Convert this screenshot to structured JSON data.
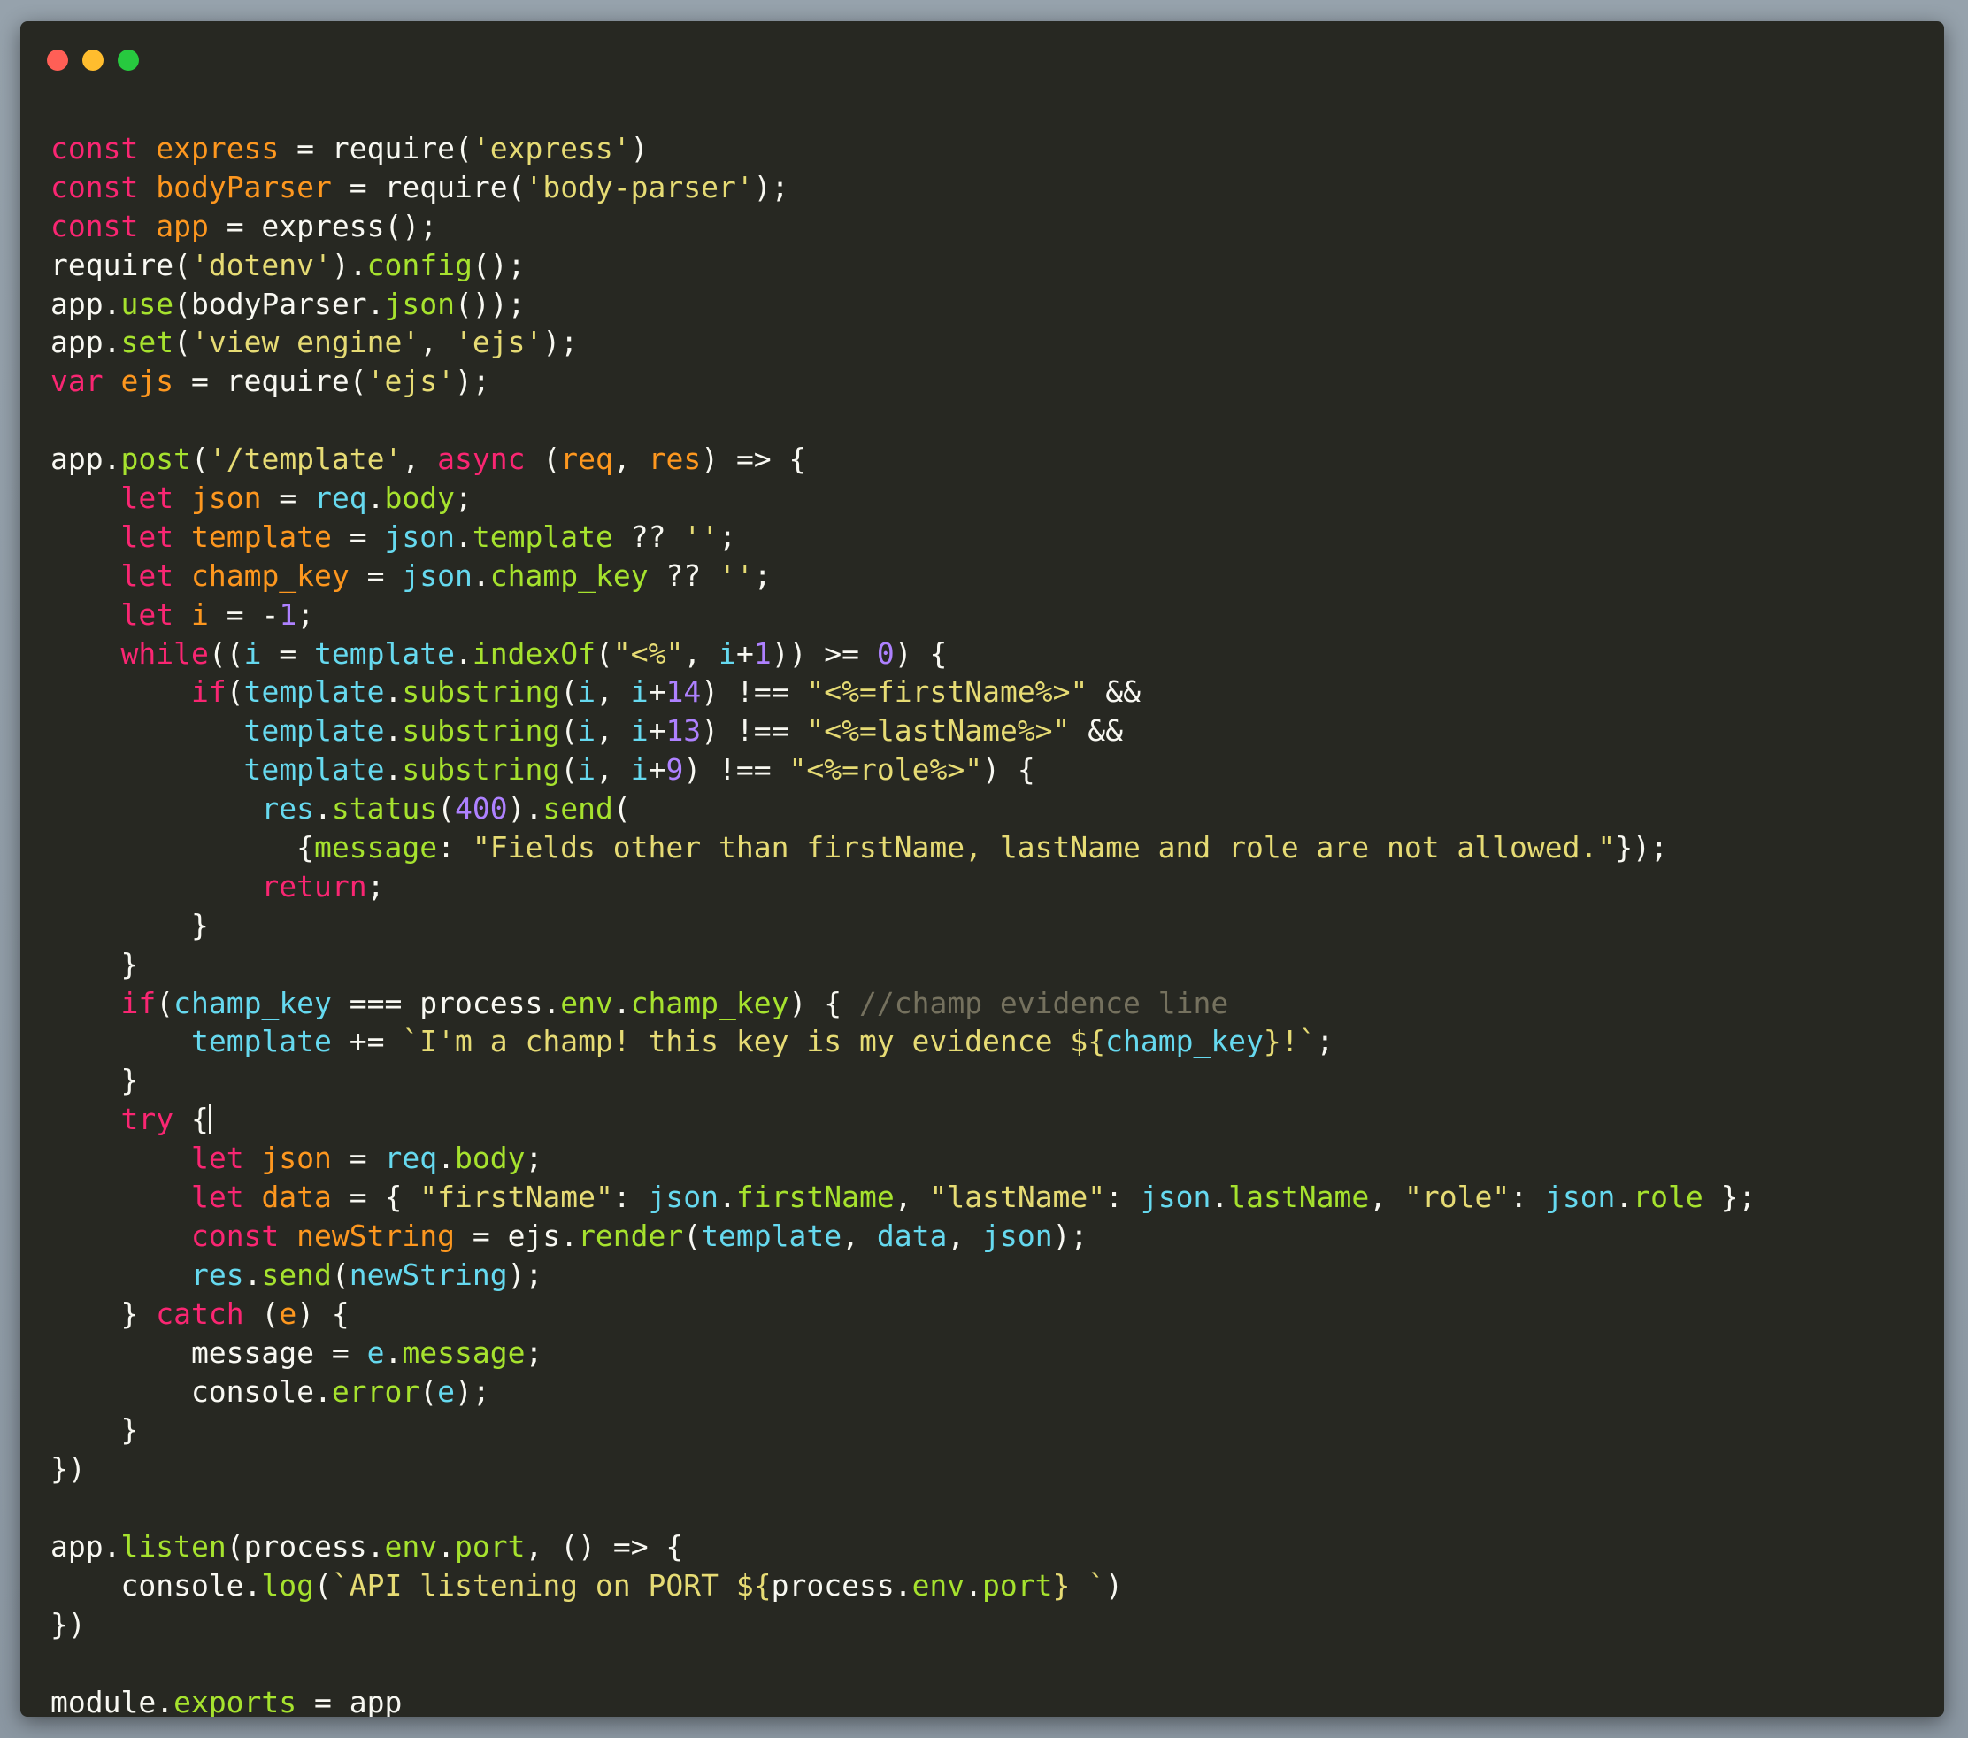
{
  "colors": {
    "background": "#272822",
    "text": "#f8f8f2",
    "keyword": "#f92672",
    "variable": "#fd971f",
    "string": "#e6db74",
    "function": "#a6e22e",
    "identifier": "#66d9ef",
    "number": "#ae81ff",
    "comment": "#75715e",
    "window_close": "#ff5f56",
    "window_minimize": "#ffbd2e",
    "window_maximize": "#27c93f"
  },
  "window_controls": [
    {
      "name": "close-button-icon",
      "color": "#ff5f56"
    },
    {
      "name": "minimize-button-icon",
      "color": "#ffbd2e"
    },
    {
      "name": "maximize-button-icon",
      "color": "#27c93f"
    }
  ],
  "cursor": {
    "line": 25
  },
  "code_lines": [
    [
      [
        "k",
        "const"
      ],
      [
        "t",
        " "
      ],
      [
        "v",
        "express"
      ],
      [
        "t",
        " = require("
      ],
      [
        "s",
        "'express'"
      ],
      [
        "t",
        ")"
      ]
    ],
    [
      [
        "k",
        "const"
      ],
      [
        "t",
        " "
      ],
      [
        "v",
        "bodyParser"
      ],
      [
        "t",
        " = require("
      ],
      [
        "s",
        "'body-parser'"
      ],
      [
        "t",
        ");"
      ]
    ],
    [
      [
        "k",
        "const"
      ],
      [
        "t",
        " "
      ],
      [
        "v",
        "app"
      ],
      [
        "t",
        " = express();"
      ]
    ],
    [
      [
        "t",
        "require("
      ],
      [
        "s",
        "'dotenv'"
      ],
      [
        "t",
        ")."
      ],
      [
        "f",
        "config"
      ],
      [
        "t",
        "();"
      ]
    ],
    [
      [
        "t",
        "app."
      ],
      [
        "f",
        "use"
      ],
      [
        "t",
        "(bodyParser."
      ],
      [
        "f",
        "json"
      ],
      [
        "t",
        "());"
      ]
    ],
    [
      [
        "t",
        "app."
      ],
      [
        "f",
        "set"
      ],
      [
        "t",
        "("
      ],
      [
        "s",
        "'view engine'"
      ],
      [
        "t",
        ", "
      ],
      [
        "s",
        "'ejs'"
      ],
      [
        "t",
        ");"
      ]
    ],
    [
      [
        "k",
        "var"
      ],
      [
        "t",
        " "
      ],
      [
        "v",
        "ejs"
      ],
      [
        "t",
        " = require("
      ],
      [
        "s",
        "'ejs'"
      ],
      [
        "t",
        ");"
      ]
    ],
    [],
    [
      [
        "t",
        "app."
      ],
      [
        "f",
        "post"
      ],
      [
        "t",
        "("
      ],
      [
        "s",
        "'/template'"
      ],
      [
        "t",
        ", "
      ],
      [
        "k",
        "async"
      ],
      [
        "t",
        " ("
      ],
      [
        "v",
        "req"
      ],
      [
        "t",
        ", "
      ],
      [
        "v",
        "res"
      ],
      [
        "t",
        ") => {"
      ]
    ],
    [
      [
        "t",
        "    "
      ],
      [
        "k",
        "let"
      ],
      [
        "t",
        " "
      ],
      [
        "v",
        "json"
      ],
      [
        "t",
        " = "
      ],
      [
        "i",
        "req"
      ],
      [
        "t",
        "."
      ],
      [
        "f",
        "body"
      ],
      [
        "t",
        ";"
      ]
    ],
    [
      [
        "t",
        "    "
      ],
      [
        "k",
        "let"
      ],
      [
        "t",
        " "
      ],
      [
        "v",
        "template"
      ],
      [
        "t",
        " = "
      ],
      [
        "i",
        "json"
      ],
      [
        "t",
        "."
      ],
      [
        "f",
        "template"
      ],
      [
        "t",
        " ?? "
      ],
      [
        "s",
        "''"
      ],
      [
        "t",
        ";"
      ]
    ],
    [
      [
        "t",
        "    "
      ],
      [
        "k",
        "let"
      ],
      [
        "t",
        " "
      ],
      [
        "v",
        "champ_key"
      ],
      [
        "t",
        " = "
      ],
      [
        "i",
        "json"
      ],
      [
        "t",
        "."
      ],
      [
        "f",
        "champ_key"
      ],
      [
        "t",
        " ?? "
      ],
      [
        "s",
        "''"
      ],
      [
        "t",
        ";"
      ]
    ],
    [
      [
        "t",
        "    "
      ],
      [
        "k",
        "let"
      ],
      [
        "t",
        " "
      ],
      [
        "v",
        "i"
      ],
      [
        "t",
        " = -"
      ],
      [
        "n",
        "1"
      ],
      [
        "t",
        ";"
      ]
    ],
    [
      [
        "t",
        "    "
      ],
      [
        "k",
        "while"
      ],
      [
        "t",
        "(("
      ],
      [
        "i",
        "i"
      ],
      [
        "t",
        " = "
      ],
      [
        "i",
        "template"
      ],
      [
        "t",
        "."
      ],
      [
        "f",
        "indexOf"
      ],
      [
        "t",
        "("
      ],
      [
        "s",
        "\"<%\""
      ],
      [
        "t",
        ", "
      ],
      [
        "i",
        "i"
      ],
      [
        "t",
        "+"
      ],
      [
        "n",
        "1"
      ],
      [
        "t",
        ")) >= "
      ],
      [
        "n",
        "0"
      ],
      [
        "t",
        ") {"
      ]
    ],
    [
      [
        "t",
        "        "
      ],
      [
        "k",
        "if"
      ],
      [
        "t",
        "("
      ],
      [
        "i",
        "template"
      ],
      [
        "t",
        "."
      ],
      [
        "f",
        "substring"
      ],
      [
        "t",
        "("
      ],
      [
        "i",
        "i"
      ],
      [
        "t",
        ", "
      ],
      [
        "i",
        "i"
      ],
      [
        "t",
        "+"
      ],
      [
        "n",
        "14"
      ],
      [
        "t",
        ") !== "
      ],
      [
        "s",
        "\"<%=firstName%>\""
      ],
      [
        "t",
        " &&"
      ]
    ],
    [
      [
        "t",
        "           "
      ],
      [
        "i",
        "template"
      ],
      [
        "t",
        "."
      ],
      [
        "f",
        "substring"
      ],
      [
        "t",
        "("
      ],
      [
        "i",
        "i"
      ],
      [
        "t",
        ", "
      ],
      [
        "i",
        "i"
      ],
      [
        "t",
        "+"
      ],
      [
        "n",
        "13"
      ],
      [
        "t",
        ") !== "
      ],
      [
        "s",
        "\"<%=lastName%>\""
      ],
      [
        "t",
        " &&"
      ]
    ],
    [
      [
        "t",
        "           "
      ],
      [
        "i",
        "template"
      ],
      [
        "t",
        "."
      ],
      [
        "f",
        "substring"
      ],
      [
        "t",
        "("
      ],
      [
        "i",
        "i"
      ],
      [
        "t",
        ", "
      ],
      [
        "i",
        "i"
      ],
      [
        "t",
        "+"
      ],
      [
        "n",
        "9"
      ],
      [
        "t",
        ") !== "
      ],
      [
        "s",
        "\"<%=role%>\""
      ],
      [
        "t",
        ") {"
      ]
    ],
    [
      [
        "t",
        "            "
      ],
      [
        "i",
        "res"
      ],
      [
        "t",
        "."
      ],
      [
        "f",
        "status"
      ],
      [
        "t",
        "("
      ],
      [
        "n",
        "400"
      ],
      [
        "t",
        ")."
      ],
      [
        "f",
        "send"
      ],
      [
        "t",
        "("
      ]
    ],
    [
      [
        "t",
        "              {"
      ],
      [
        "f",
        "message"
      ],
      [
        "t",
        ": "
      ],
      [
        "s",
        "\"Fields other than firstName, lastName and role are not allowed.\""
      ],
      [
        "t",
        "});"
      ]
    ],
    [
      [
        "t",
        "            "
      ],
      [
        "k",
        "return"
      ],
      [
        "t",
        ";"
      ]
    ],
    [
      [
        "t",
        "        }"
      ]
    ],
    [
      [
        "t",
        "    }"
      ]
    ],
    [
      [
        "t",
        "    "
      ],
      [
        "k",
        "if"
      ],
      [
        "t",
        "("
      ],
      [
        "i",
        "champ_key"
      ],
      [
        "t",
        " === process."
      ],
      [
        "f",
        "env"
      ],
      [
        "t",
        "."
      ],
      [
        "f",
        "champ_key"
      ],
      [
        "t",
        ") { "
      ],
      [
        "c",
        "//champ evidence line"
      ]
    ],
    [
      [
        "t",
        "        "
      ],
      [
        "i",
        "template"
      ],
      [
        "t",
        " += "
      ],
      [
        "s",
        "`I'm a champ! this key is my evidence ${"
      ],
      [
        "i",
        "champ_key"
      ],
      [
        "s",
        "}!`"
      ],
      [
        "t",
        ";"
      ]
    ],
    [
      [
        "t",
        "    }"
      ]
    ],
    [
      [
        "t",
        "    "
      ],
      [
        "k",
        "try"
      ],
      [
        "t",
        " {"
      ]
    ],
    [
      [
        "t",
        "        "
      ],
      [
        "k",
        "let"
      ],
      [
        "t",
        " "
      ],
      [
        "v",
        "json"
      ],
      [
        "t",
        " = "
      ],
      [
        "i",
        "req"
      ],
      [
        "t",
        "."
      ],
      [
        "f",
        "body"
      ],
      [
        "t",
        ";"
      ]
    ],
    [
      [
        "t",
        "        "
      ],
      [
        "k",
        "let"
      ],
      [
        "t",
        " "
      ],
      [
        "v",
        "data"
      ],
      [
        "t",
        " = { "
      ],
      [
        "s",
        "\"firstName\""
      ],
      [
        "t",
        ": "
      ],
      [
        "i",
        "json"
      ],
      [
        "t",
        "."
      ],
      [
        "f",
        "firstName"
      ],
      [
        "t",
        ", "
      ],
      [
        "s",
        "\"lastName\""
      ],
      [
        "t",
        ": "
      ],
      [
        "i",
        "json"
      ],
      [
        "t",
        "."
      ],
      [
        "f",
        "lastName"
      ],
      [
        "t",
        ", "
      ],
      [
        "s",
        "\"role\""
      ],
      [
        "t",
        ": "
      ],
      [
        "i",
        "json"
      ],
      [
        "t",
        "."
      ],
      [
        "f",
        "role"
      ],
      [
        "t",
        " };"
      ]
    ],
    [
      [
        "t",
        "        "
      ],
      [
        "k",
        "const"
      ],
      [
        "t",
        " "
      ],
      [
        "v",
        "newString"
      ],
      [
        "t",
        " = ejs."
      ],
      [
        "f",
        "render"
      ],
      [
        "t",
        "("
      ],
      [
        "i",
        "template"
      ],
      [
        "t",
        ", "
      ],
      [
        "i",
        "data"
      ],
      [
        "t",
        ", "
      ],
      [
        "i",
        "json"
      ],
      [
        "t",
        ");"
      ]
    ],
    [
      [
        "t",
        "        "
      ],
      [
        "i",
        "res"
      ],
      [
        "t",
        "."
      ],
      [
        "f",
        "send"
      ],
      [
        "t",
        "("
      ],
      [
        "i",
        "newString"
      ],
      [
        "t",
        ");"
      ]
    ],
    [
      [
        "t",
        "    } "
      ],
      [
        "k",
        "catch"
      ],
      [
        "t",
        " ("
      ],
      [
        "v",
        "e"
      ],
      [
        "t",
        ") {"
      ]
    ],
    [
      [
        "t",
        "        message = "
      ],
      [
        "i",
        "e"
      ],
      [
        "t",
        "."
      ],
      [
        "f",
        "message"
      ],
      [
        "t",
        ";"
      ]
    ],
    [
      [
        "t",
        "        console."
      ],
      [
        "f",
        "error"
      ],
      [
        "t",
        "("
      ],
      [
        "i",
        "e"
      ],
      [
        "t",
        ");"
      ]
    ],
    [
      [
        "t",
        "    }"
      ]
    ],
    [
      [
        "t",
        "})"
      ]
    ],
    [],
    [
      [
        "t",
        "app."
      ],
      [
        "f",
        "listen"
      ],
      [
        "t",
        "(process."
      ],
      [
        "f",
        "env"
      ],
      [
        "t",
        "."
      ],
      [
        "f",
        "port"
      ],
      [
        "t",
        ", () => {"
      ]
    ],
    [
      [
        "t",
        "    console."
      ],
      [
        "f",
        "log"
      ],
      [
        "t",
        "("
      ],
      [
        "s",
        "`API listening on PORT ${"
      ],
      [
        "t",
        "process."
      ],
      [
        "f",
        "env"
      ],
      [
        "t",
        "."
      ],
      [
        "f",
        "port"
      ],
      [
        "s",
        "} `"
      ],
      [
        "t",
        ")"
      ]
    ],
    [
      [
        "t",
        "})"
      ]
    ],
    [],
    [
      [
        "t",
        "module."
      ],
      [
        "f",
        "exports"
      ],
      [
        "t",
        " = app"
      ]
    ]
  ]
}
